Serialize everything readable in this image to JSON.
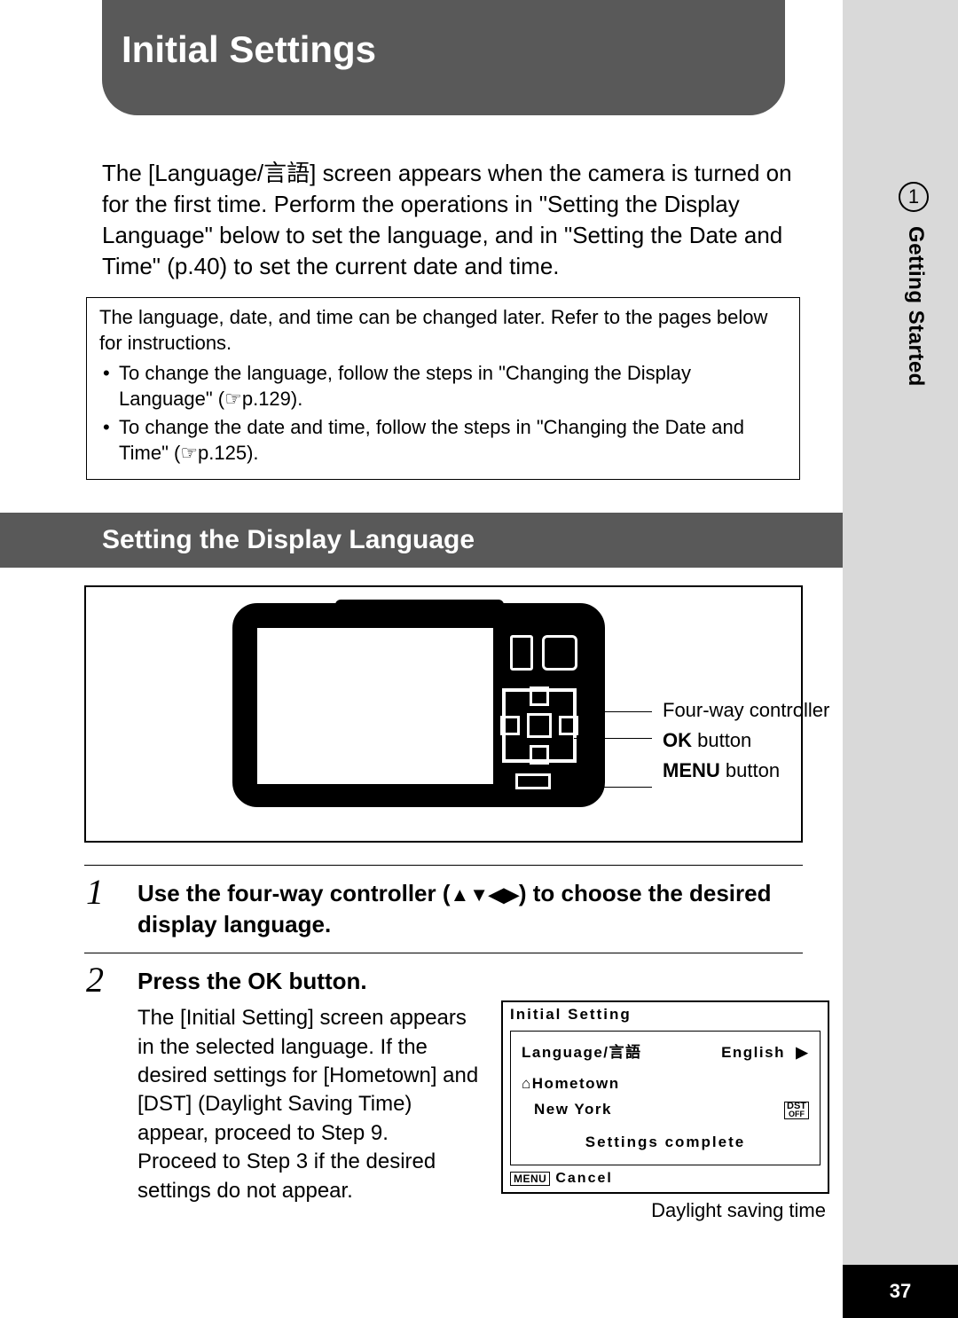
{
  "page_number": "37",
  "side": {
    "number": "1",
    "label": "Getting Started"
  },
  "title": "Initial Settings",
  "intro": "The [Language/言語] screen appears when the camera is turned on for the first time. Perform the operations in \"Setting the Display Language\" below to set the language, and in \"Setting the Date and Time\" (p.40) to set the current date and time.",
  "note": {
    "lead": "The language, date, and time can be changed later. Refer to the pages below for instructions.",
    "bullets": [
      "To change the language, follow the steps in \"Changing the Display Language\" (☞p.129).",
      "To change the date and time, follow the steps in \"Changing the Date and Time\" (☞p.125)."
    ]
  },
  "subhead": "Setting the Display Language",
  "figure": {
    "label_fourway": "Four-way controller",
    "label_ok_bold": "OK",
    "label_ok_rest": " button",
    "label_menu_bold": "MENU",
    "label_menu_rest": " button"
  },
  "steps": [
    {
      "num": "1",
      "title_pre": "Use the four-way controller (",
      "title_arrows": "▲▼◀▶",
      "title_post": ") to choose the desired display language."
    },
    {
      "num": "2",
      "title_pre": "Press the ",
      "title_bold": "OK",
      "title_post": " button.",
      "body": "The [Initial Setting] screen appears in the selected language. If the desired settings for [Hometown] and [DST] (Daylight Saving Time) appear, proceed to Step 9.\nProceed to Step 3 if the desired settings do not appear."
    }
  ],
  "lcd": {
    "title": "Initial Setting",
    "lang_label": "Language/言語",
    "lang_value": "English",
    "lang_arrow": "▶",
    "home_icon": "⌂",
    "home_label": "Hometown",
    "city": "New York",
    "dst_top": "DST",
    "dst_bottom": "OFF",
    "complete": "Settings complete",
    "foot_menu": "MENU",
    "foot_cancel": "Cancel",
    "caption": "Daylight saving time"
  }
}
